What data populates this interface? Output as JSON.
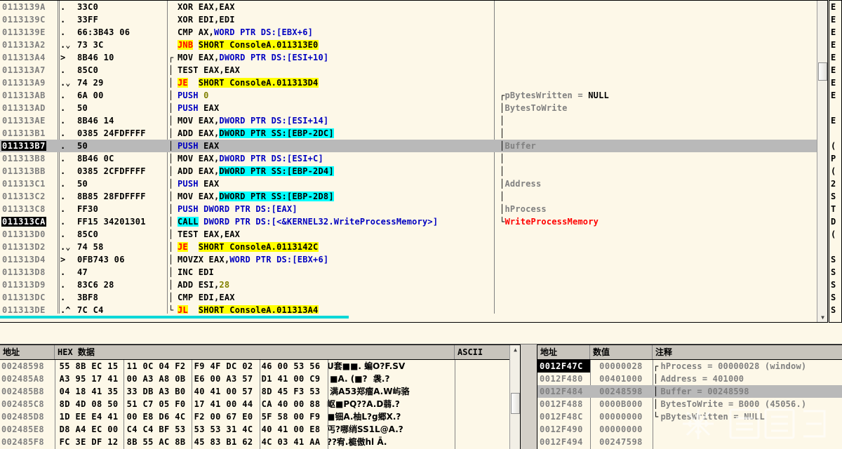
{
  "disassembly": {
    "columns": [
      "address",
      "mark",
      "hexdump",
      "disassembly",
      "comment"
    ],
    "rows": [
      {
        "addr": "0113139A",
        "mark": ".",
        "hex": "33C0",
        "arrow": "",
        "text": [
          {
            "t": "XOR EAX,EAX",
            "c": "black"
          }
        ],
        "cmt": []
      },
      {
        "addr": "0113139C",
        "mark": ".",
        "hex": "33FF",
        "arrow": "",
        "text": [
          {
            "t": "XOR EDI,EDI",
            "c": "black"
          }
        ],
        "cmt": []
      },
      {
        "addr": "0113139E",
        "mark": ".",
        "hex": "66:3B43 06",
        "arrow": "",
        "text": [
          {
            "t": "CMP AX,",
            "c": "black"
          },
          {
            "t": "WORD PTR DS:[EBX+6]",
            "c": "blue"
          }
        ],
        "cmt": []
      },
      {
        "addr": "011313A2",
        "mark": ".⌄",
        "hex": "73 3C",
        "arrow": "",
        "text": [
          {
            "t": "JNB",
            "c": "jmp"
          },
          {
            "t": " ",
            "c": "black"
          },
          {
            "t": "SHORT ConsoleA.011313E0",
            "c": "yellowbg"
          }
        ],
        "cmt": []
      },
      {
        "addr": "011313A4",
        "mark": ">",
        "hex": "8B46 10",
        "arrow": "┌",
        "text": [
          {
            "t": "MOV EAX,",
            "c": "black"
          },
          {
            "t": "DWORD PTR DS:[ESI+10]",
            "c": "blue"
          }
        ],
        "cmt": []
      },
      {
        "addr": "011313A7",
        "mark": ".",
        "hex": "85C0",
        "arrow": "│",
        "text": [
          {
            "t": "TEST EAX,EAX",
            "c": "black"
          }
        ],
        "cmt": []
      },
      {
        "addr": "011313A9",
        "mark": ".⌄",
        "hex": "74 29",
        "arrow": "│",
        "text": [
          {
            "t": "JE",
            "c": "jmp"
          },
          {
            "t": "  ",
            "c": "black"
          },
          {
            "t": "SHORT ConsoleA.011313D4",
            "c": "yellowbg"
          }
        ],
        "cmt": []
      },
      {
        "addr": "011313AB",
        "mark": ".",
        "hex": "6A 00",
        "arrow": "│",
        "text": [
          {
            "t": "PUSH ",
            "c": "blue"
          },
          {
            "t": "0",
            "c": "olive"
          }
        ],
        "cmt": [
          {
            "t": "pBytesWritten = ",
            "c": "gray"
          },
          {
            "t": "NULL",
            "c": "black"
          }
        ],
        "cb": "top"
      },
      {
        "addr": "011313AD",
        "mark": ".",
        "hex": "50",
        "arrow": "│",
        "text": [
          {
            "t": "PUSH ",
            "c": "blue"
          },
          {
            "t": "EAX",
            "c": "black"
          }
        ],
        "cmt": [
          {
            "t": "BytesToWrite",
            "c": "gray"
          }
        ],
        "cb": "mid"
      },
      {
        "addr": "011313AE",
        "mark": ".",
        "hex": "8B46 14",
        "arrow": "│",
        "text": [
          {
            "t": "MOV EAX,",
            "c": "black"
          },
          {
            "t": "DWORD PTR DS:[ESI+14]",
            "c": "blue"
          }
        ],
        "cmt": [],
        "cb": "mid"
      },
      {
        "addr": "011313B1",
        "mark": ".",
        "hex": "0385 24FDFFFF",
        "arrow": "│",
        "text": [
          {
            "t": "ADD EAX,",
            "c": "black"
          },
          {
            "t": "DWORD PTR SS:[EBP-2DC]",
            "c": "cyanbg"
          }
        ],
        "cmt": [],
        "cb": "mid"
      },
      {
        "addr": "011313B7",
        "mark": ".",
        "hex": "50",
        "arrow": "│",
        "text": [
          {
            "t": "PUSH ",
            "c": "blue"
          },
          {
            "t": "EAX",
            "c": "black"
          }
        ],
        "cmt": [
          {
            "t": "Buffer",
            "c": "gray"
          }
        ],
        "sel": true,
        "cb": "mid"
      },
      {
        "addr": "011313B8",
        "mark": ".",
        "hex": "8B46 0C",
        "arrow": "│",
        "text": [
          {
            "t": "MOV EAX,",
            "c": "black"
          },
          {
            "t": "DWORD PTR DS:[ESI+C]",
            "c": "blue"
          }
        ],
        "cmt": [],
        "cb": "mid"
      },
      {
        "addr": "011313BB",
        "mark": ".",
        "hex": "0385 2CFDFFFF",
        "arrow": "│",
        "text": [
          {
            "t": "ADD EAX,",
            "c": "black"
          },
          {
            "t": "DWORD PTR SS:[EBP-2D4]",
            "c": "cyanbg"
          }
        ],
        "cmt": [],
        "cb": "mid"
      },
      {
        "addr": "011313C1",
        "mark": ".",
        "hex": "50",
        "arrow": "│",
        "text": [
          {
            "t": "PUSH ",
            "c": "blue"
          },
          {
            "t": "EAX",
            "c": "black"
          }
        ],
        "cmt": [
          {
            "t": "Address",
            "c": "gray"
          }
        ],
        "cb": "mid"
      },
      {
        "addr": "011313C2",
        "mark": ".",
        "hex": "8B85 28FDFFFF",
        "arrow": "│",
        "text": [
          {
            "t": "MOV EAX,",
            "c": "black"
          },
          {
            "t": "DWORD PTR SS:[EBP-2D8]",
            "c": "cyanbg"
          }
        ],
        "cmt": [],
        "cb": "mid"
      },
      {
        "addr": "011313C8",
        "mark": ".",
        "hex": "FF30",
        "arrow": "│",
        "text": [
          {
            "t": "PUSH ",
            "c": "blue"
          },
          {
            "t": "DWORD PTR DS:[EAX]",
            "c": "blue"
          }
        ],
        "cmt": [
          {
            "t": "hProcess",
            "c": "gray"
          }
        ],
        "cb": "mid"
      },
      {
        "addr": "011313CA",
        "mark": ".",
        "hex": "FF15 34201301",
        "arrow": "│",
        "text": [
          {
            "t": "CALL",
            "c": "call"
          },
          {
            "t": " ",
            "c": "black"
          },
          {
            "t": "DWORD PTR DS:[<&KERNEL32.WriteProcessMemory>]",
            "c": "blue"
          }
        ],
        "cmt": [
          {
            "t": "WriteProcessMemory",
            "c": "red"
          }
        ],
        "eip": true,
        "cb": "bot"
      },
      {
        "addr": "011313D0",
        "mark": ".",
        "hex": "85C0",
        "arrow": "│",
        "text": [
          {
            "t": "TEST EAX,EAX",
            "c": "black"
          }
        ],
        "cmt": []
      },
      {
        "addr": "011313D2",
        "mark": ".⌄",
        "hex": "74 58",
        "arrow": "│",
        "text": [
          {
            "t": "JE",
            "c": "jmp"
          },
          {
            "t": "  ",
            "c": "black"
          },
          {
            "t": "SHORT ConsoleA.0113142C",
            "c": "yellowbg"
          }
        ],
        "cmt": []
      },
      {
        "addr": "011313D4",
        "mark": ">",
        "hex": "0FB743 06",
        "arrow": "│",
        "text": [
          {
            "t": "MOVZX EAX,",
            "c": "black"
          },
          {
            "t": "WORD PTR DS:[EBX+6]",
            "c": "blue"
          }
        ],
        "cmt": []
      },
      {
        "addr": "011313D8",
        "mark": ".",
        "hex": "47",
        "arrow": "│",
        "text": [
          {
            "t": "INC EDI",
            "c": "black"
          }
        ],
        "cmt": []
      },
      {
        "addr": "011313D9",
        "mark": ".",
        "hex": "83C6 28",
        "arrow": "│",
        "text": [
          {
            "t": "ADD ESI,",
            "c": "black"
          },
          {
            "t": "28",
            "c": "olive"
          }
        ],
        "cmt": []
      },
      {
        "addr": "011313DC",
        "mark": ".",
        "hex": "3BF8",
        "arrow": "│",
        "text": [
          {
            "t": "CMP EDI,EAX",
            "c": "black"
          }
        ],
        "cmt": []
      },
      {
        "addr": "011313DE",
        "mark": ".^",
        "hex": "7C C4",
        "arrow": "└",
        "text": [
          {
            "t": "JL",
            "c": "jmp"
          },
          {
            "t": "  ",
            "c": "black"
          },
          {
            "t": "SHORT ConsoleA.011313A4",
            "c": "yellowbg"
          }
        ],
        "cmt": []
      }
    ]
  },
  "dump": {
    "headers": [
      {
        "label": "地址",
        "name": "address"
      },
      {
        "label": "HEX 数据",
        "name": "hex-data"
      },
      {
        "label": "ASCII",
        "name": "ascii"
      }
    ],
    "rows": [
      {
        "addr": "00248598",
        "bytes": [
          "55",
          "8B",
          "EC",
          "15",
          "11",
          "0C",
          "04",
          "F2",
          "F9",
          "4F",
          "DC",
          "02",
          "46",
          "00",
          "53",
          "56"
        ],
        "ascii": "U套■■. 蝙O?F.SV"
      },
      {
        "addr": "002485A8",
        "bytes": [
          "A3",
          "95",
          "17",
          "41",
          "00",
          "A3",
          "A8",
          "0B",
          "E6",
          "00",
          "A3",
          "57",
          "D1",
          "41",
          "00",
          "C9"
        ],
        "ascii": " ■A. (■?  袰.?"
      },
      {
        "addr": "002485B8",
        "bytes": [
          "04",
          "18",
          "41",
          "35",
          "33",
          "DB",
          "A3",
          "B0",
          "40",
          "41",
          "00",
          "57",
          "8D",
          "45",
          "F3",
          "53"
        ],
        "ascii": " 满A53郑瘤A.W屿骆"
      },
      {
        "addr": "002485C8",
        "bytes": [
          "8D",
          "4D",
          "08",
          "50",
          "51",
          "C7",
          "05",
          "F0",
          "17",
          "41",
          "00",
          "44",
          "CA",
          "40",
          "00",
          "88"
        ],
        "ascii": "岖■PQ??A.D蒻.?"
      },
      {
        "addr": "002485D8",
        "bytes": [
          "1D",
          "EE",
          "E4",
          "41",
          "00",
          "E8",
          "D6",
          "4C",
          "F2",
          "00",
          "67",
          "E0",
          "5F",
          "58",
          "00",
          "F9"
        ],
        "ascii": "■钿A.柚L?g郷X.?"
      },
      {
        "addr": "002485E8",
        "bytes": [
          "D8",
          "A4",
          "EC",
          "00",
          "C4",
          "C4",
          "BF",
          "53",
          "53",
          "53",
          "31",
          "4C",
          "40",
          "41",
          "00",
          "E8"
        ],
        "ascii": "丐?哪绡SS1L@A.?"
      },
      {
        "addr": "002485F8",
        "bytes": [
          "FC",
          "3E",
          "DF",
          "12",
          "8B",
          "55",
          "AC",
          "8B",
          "45",
          "83",
          "B1",
          "62",
          "4C",
          "03",
          "41",
          "AA"
        ],
        "ascii": "??宥.榳傲hl Ā."
      }
    ]
  },
  "stack": {
    "headers": [
      {
        "label": "地址",
        "name": "address"
      },
      {
        "label": "数值",
        "name": "value"
      },
      {
        "label": "注释",
        "name": "comment"
      }
    ],
    "rows": [
      {
        "addr": "0012F47C",
        "val": "00000028",
        "cmt": "hProcess = 00000028 (window)",
        "esp": true,
        "cb": "top"
      },
      {
        "addr": "0012F480",
        "val": "00401000",
        "cmt": "Address = 401000",
        "cb": "mid"
      },
      {
        "addr": "0012F484",
        "val": "00248598",
        "cmt": "Buffer = 00248598",
        "sel": true,
        "cb": "mid"
      },
      {
        "addr": "0012F488",
        "val": "0000B000",
        "cmt": "BytesToWrite = B000 (45056.)",
        "cb": "mid"
      },
      {
        "addr": "0012F48C",
        "val": "00000000",
        "cmt": "pBytesWritten = NULL",
        "cb": "bot"
      },
      {
        "addr": "0012F490",
        "val": "00000000",
        "cmt": ""
      },
      {
        "addr": "0012F494",
        "val": "00247598",
        "cmt": ""
      }
    ]
  },
  "registers_strip": {
    "rows": [
      "E",
      "E",
      "E",
      "E",
      "E",
      "E",
      "E",
      "E",
      "",
      "E",
      "",
      "(",
      "P",
      "(",
      "2",
      "S",
      "T",
      "D",
      "(",
      "",
      "S",
      "S",
      "S",
      "S",
      "S"
    ]
  },
  "colors": {
    "pane_bg": "#fdf8e8",
    "chrome": "#d4d0c8",
    "header_bg": "#c8c4bc",
    "selection": "#b9b9b9",
    "eip_bg": "#000000",
    "jump_highlight": "#ffff00",
    "operand_highlight": "#00ffff",
    "api_name": "#ff0000",
    "operand_blue": "#0000c0",
    "address_gray": "#808080",
    "scrollbar_thumb_cyan": "#00d8d8"
  }
}
